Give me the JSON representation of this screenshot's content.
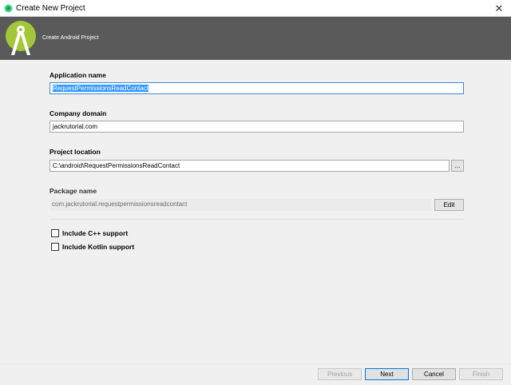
{
  "window": {
    "title": "Create New Project",
    "close_glyph": "✕"
  },
  "header": {
    "title": "Create Android Project",
    "icon": "android-studio-logo-icon",
    "bg_color": "#5a5a5a"
  },
  "form": {
    "application_name": {
      "label": "Application name",
      "value": "RequestPermissionsReadContact"
    },
    "company_domain": {
      "label": "Company domain",
      "value": "jackrutorial.com"
    },
    "project_location": {
      "label": "Project location",
      "value": "C:\\android\\RequestPermissionsReadContact",
      "browse_label": "..."
    },
    "package_name": {
      "label": "Package name",
      "value": "com.jackrutorial.requestpermissionsreadcontact",
      "edit_label": "Edit"
    },
    "include_cpp": {
      "label": "Include C++ support",
      "checked": false
    },
    "include_kotlin": {
      "label": "Include Kotlin support",
      "checked": false
    }
  },
  "footer": {
    "previous": "Previous",
    "next": "Next",
    "cancel": "Cancel",
    "finish": "Finish"
  },
  "colors": {
    "accent": "#3c8ad6",
    "selection": "#3399ff",
    "android_green": "#a4c639"
  }
}
